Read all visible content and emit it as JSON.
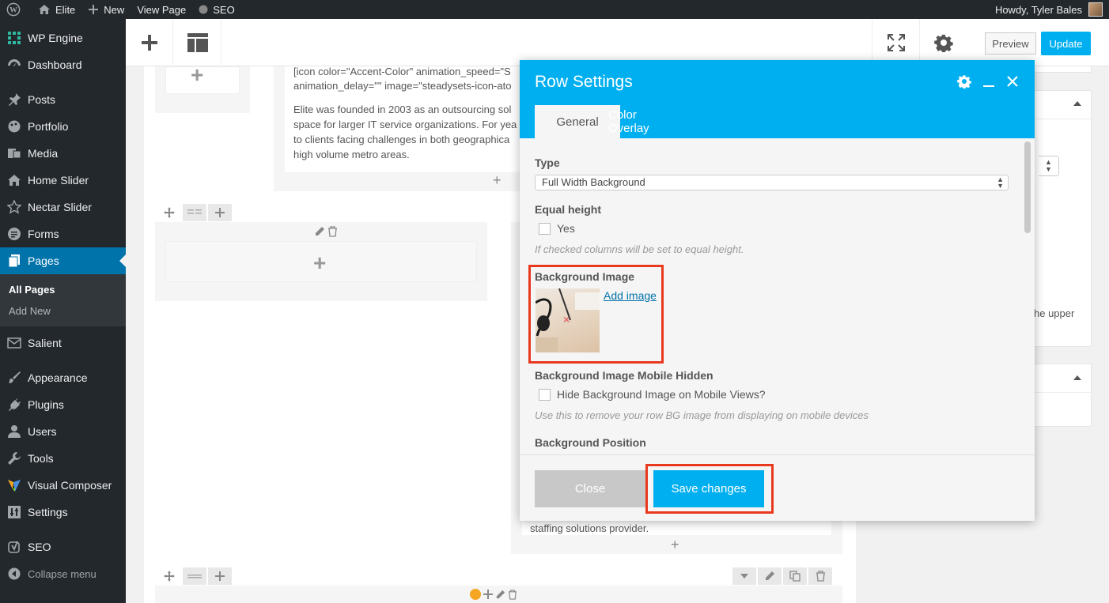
{
  "admin_bar": {
    "site_name": "Elite",
    "new_label": "New",
    "view_page_label": "View Page",
    "seo_label": "SEO",
    "greeting": "Howdy, Tyler Bales"
  },
  "sidebar": {
    "items": [
      {
        "label": "WP Engine",
        "icon": "wpengine-icon"
      },
      {
        "label": "Dashboard",
        "icon": "dashboard-icon"
      },
      {
        "label": "Posts",
        "icon": "pin-icon"
      },
      {
        "label": "Portfolio",
        "icon": "portfolio-icon"
      },
      {
        "label": "Media",
        "icon": "media-icon"
      },
      {
        "label": "Home Slider",
        "icon": "home-icon"
      },
      {
        "label": "Nectar Slider",
        "icon": "star-icon"
      },
      {
        "label": "Forms",
        "icon": "forms-icon"
      },
      {
        "label": "Pages",
        "icon": "pages-icon"
      },
      {
        "label": "Salient",
        "icon": "mail-icon"
      },
      {
        "label": "Appearance",
        "icon": "brush-icon"
      },
      {
        "label": "Plugins",
        "icon": "plug-icon"
      },
      {
        "label": "Users",
        "icon": "user-icon"
      },
      {
        "label": "Tools",
        "icon": "wrench-icon"
      },
      {
        "label": "Visual Composer",
        "icon": "vc-icon"
      },
      {
        "label": "Settings",
        "icon": "settings-icon"
      },
      {
        "label": "SEO",
        "icon": "seo-icon"
      }
    ],
    "submenu": [
      "All Pages",
      "Add New"
    ],
    "collapse_label": "Collapse menu"
  },
  "toolbar": {
    "preview_label": "Preview",
    "update_label": "Update"
  },
  "content": {
    "shortcode_line1": "[icon color=\"Accent-Color\" animation_speed=\"S",
    "shortcode_line2": "animation_delay=\"\" image=\"steadysets-icon-ato",
    "para_line1": "Elite was founded in 2003 as an outsourcing sol",
    "para_line2": "space for larger IT service organizations. For yea",
    "para_line3": "to clients facing challenges in both geographica",
    "para_line4": "high volume metro areas.",
    "partial_text_bottom": "staffing solutions provider.",
    "right_snippet": "he upper"
  },
  "modal": {
    "title": "Row Settings",
    "tabs": [
      "General",
      "Color Overlay"
    ],
    "type_label": "Type",
    "type_value": "Full Width Background",
    "equal_height_label": "Equal height",
    "equal_height_option": "Yes",
    "equal_height_hint": "If checked columns will be set to equal height.",
    "bg_image_label": "Background Image",
    "add_image_label": "Add image",
    "bg_mobile_label": "Background Image Mobile Hidden",
    "bg_mobile_option": "Hide Background Image on Mobile Views?",
    "bg_mobile_hint": "Use this to remove your row BG image from displaying on mobile devices",
    "bg_position_label": "Background Position",
    "close_label": "Close",
    "save_label": "Save changes"
  },
  "colors": {
    "accent": "#00aff0",
    "admin_dark": "#23282d",
    "active_menu": "#0073aa",
    "highlight": "#e8391f"
  }
}
